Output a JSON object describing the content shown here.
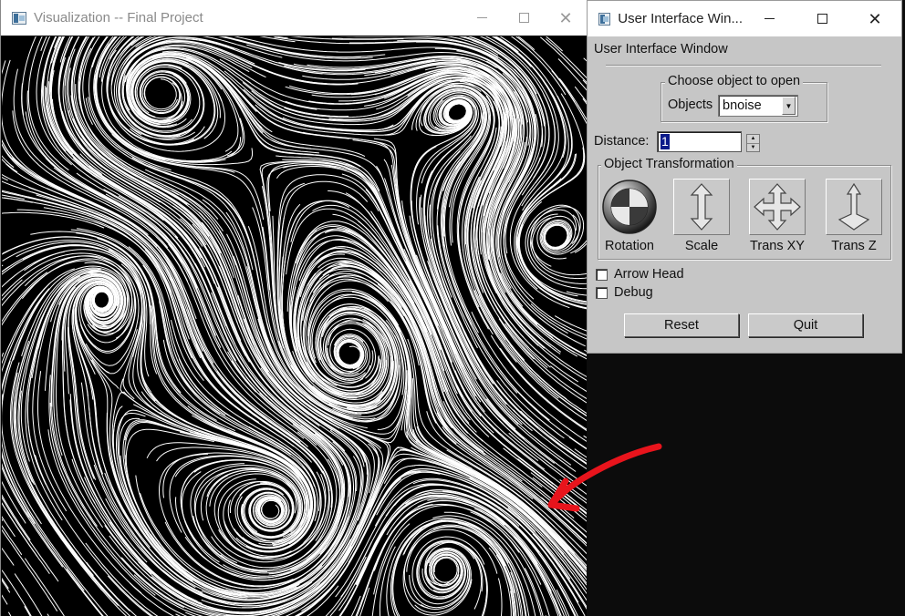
{
  "viz_window": {
    "title": "Visualization -- Final Project",
    "minimize_glyph": "—",
    "maximize_glyph": "☐",
    "close_glyph": "✕"
  },
  "ui_window": {
    "title": "User Interface Win...",
    "heading": "User Interface Window",
    "choose_object": {
      "legend": "Choose object to open",
      "objects_label": "Objects",
      "objects_value": "bnoise"
    },
    "distance": {
      "label": "Distance:",
      "value": "1"
    },
    "object_transformation": {
      "legend": "Object Transformation",
      "tools": [
        {
          "label": "Rotation",
          "icon": "rotation-ball-icon"
        },
        {
          "label": "Scale",
          "icon": "scale-arrow-icon"
        },
        {
          "label": "Trans XY",
          "icon": "move-xy-icon"
        },
        {
          "label": "Trans Z",
          "icon": "move-z-icon"
        }
      ]
    },
    "checkboxes": {
      "arrow_head": {
        "label": "Arrow Head",
        "checked": false
      },
      "debug": {
        "label": "Debug",
        "checked": false
      }
    },
    "buttons": {
      "reset": "Reset",
      "quit": "Quit"
    }
  },
  "colors": {
    "panel_bg": "#c6c6c6",
    "viz_bg": "#000000",
    "streamline": "#ffffff",
    "annotation_arrow": "#e8141c",
    "selection": "#0c1a8a"
  }
}
